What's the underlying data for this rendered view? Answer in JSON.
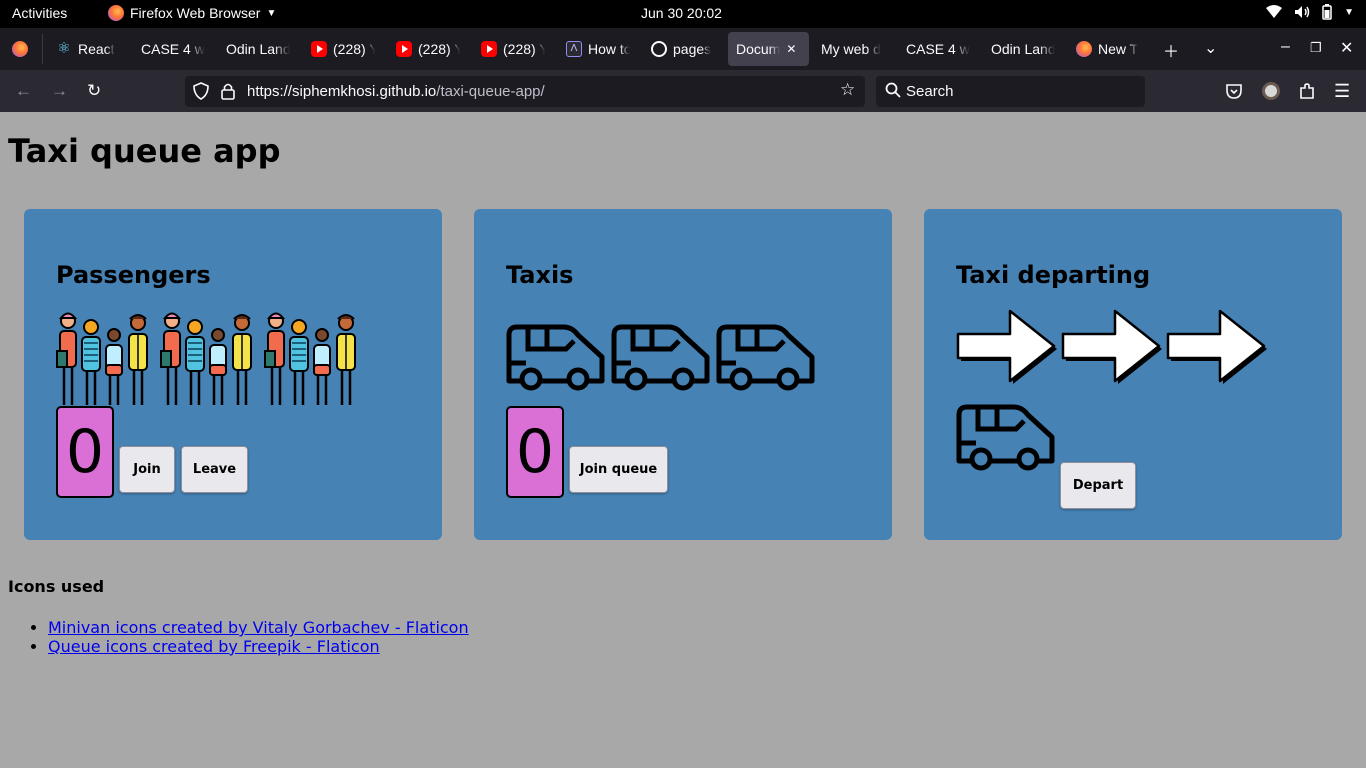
{
  "system_bar": {
    "activities": "Activities",
    "app_name": "Firefox Web Browser",
    "clock": "Jun 30  20:02"
  },
  "browser": {
    "tabs": [
      {
        "label": "React",
        "icon": "react-icon"
      },
      {
        "label": "CASE 4 w",
        "icon": "none"
      },
      {
        "label": "Odin Land",
        "icon": "none"
      },
      {
        "label": "(228) Y",
        "icon": "youtube-icon"
      },
      {
        "label": "(228) Y",
        "icon": "youtube-icon"
      },
      {
        "label": "(228) Y",
        "icon": "youtube-icon"
      },
      {
        "label": "How to",
        "icon": "devto-icon"
      },
      {
        "label": "pages",
        "icon": "github-icon"
      },
      {
        "label": "Docum",
        "icon": "none",
        "active": true
      },
      {
        "label": "My web d",
        "icon": "none"
      },
      {
        "label": "CASE 4 w",
        "icon": "none"
      },
      {
        "label": "Odin Land",
        "icon": "none"
      },
      {
        "label": "New T",
        "icon": "firefox-icon"
      }
    ],
    "url_host": "https://siphemkhosi.github.io",
    "url_path": "/taxi-queue-app/",
    "search_placeholder": "Search"
  },
  "page": {
    "title": "Taxi queue app",
    "passengers": {
      "heading": "Passengers",
      "count": "0",
      "join_label": "Join",
      "leave_label": "Leave"
    },
    "taxis": {
      "heading": "Taxis",
      "count": "0",
      "join_queue_label": "Join queue"
    },
    "departing": {
      "heading": "Taxi departing",
      "depart_label": "Depart"
    },
    "icons_used_heading": "Icons used",
    "credits": [
      "Minivan icons created by Vitaly Gorbachev - Flaticon",
      "Queue icons created by Freepik - Flaticon"
    ]
  },
  "colors": {
    "page_bg": "#a8a8a8",
    "card_bg": "#4682b4",
    "counter_bg": "#da70d6",
    "link": "#0000ee"
  }
}
